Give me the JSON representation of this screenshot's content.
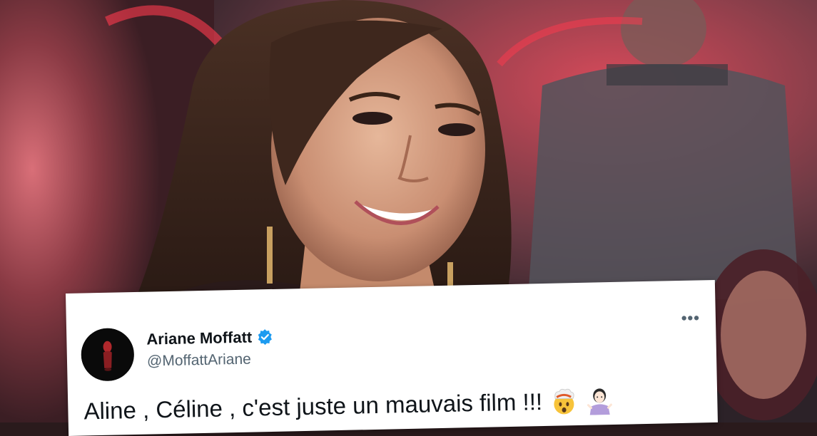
{
  "tweet": {
    "display_name": "Ariane Moffatt",
    "handle": "@MoffattAriane",
    "text": "Aline , Céline , c'est juste un mauvais film !!!",
    "verified": true,
    "emojis": [
      "exploding-head-emoji",
      "person-shrugging-emoji"
    ]
  },
  "colors": {
    "card_background": "#ffffff",
    "name_color": "#0f1419",
    "handle_color": "#536471",
    "verified_blue": "#1d9bf0",
    "stage_red": "#c8283c"
  },
  "icons": {
    "verified": "verified-badge-icon",
    "more": "more-options-icon"
  }
}
